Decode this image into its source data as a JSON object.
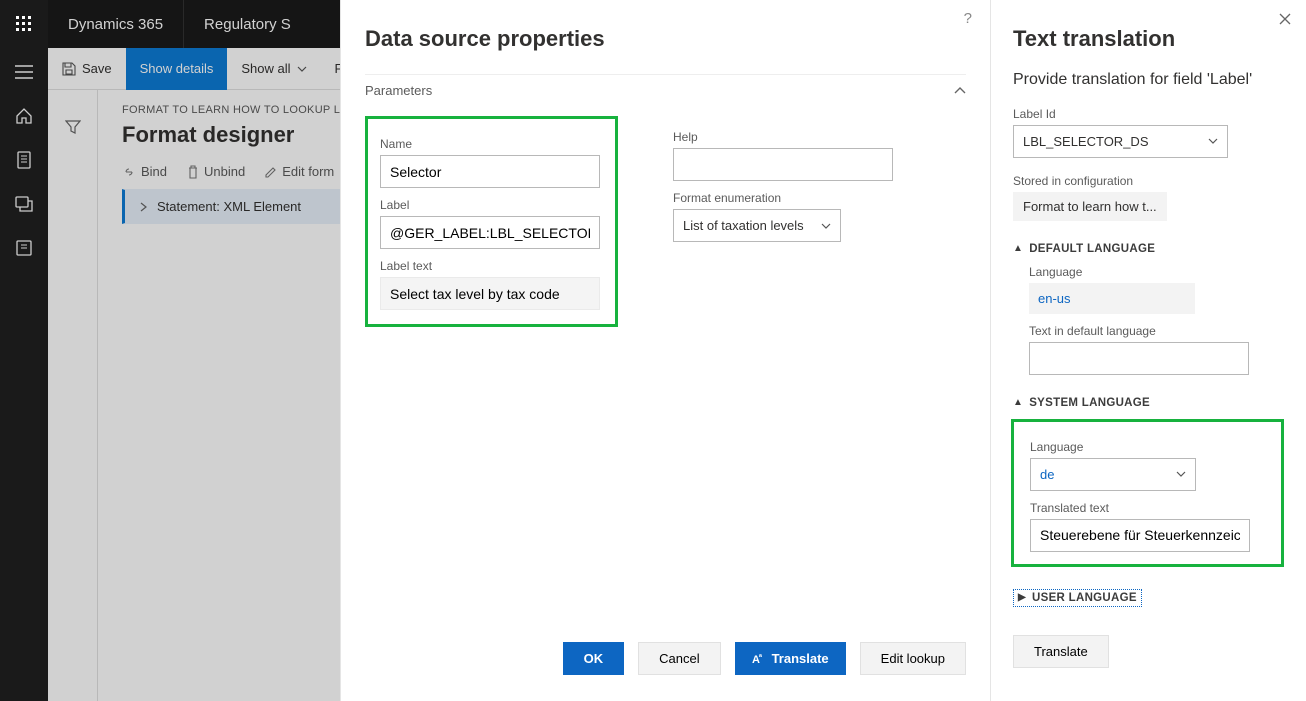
{
  "topbar": {
    "product": "Dynamics 365",
    "app": "Regulatory S"
  },
  "cmdbar": {
    "save": "Save",
    "show_details": "Show details",
    "show_all": "Show all",
    "fo": "Fo"
  },
  "page": {
    "crumb": "FORMAT TO LEARN HOW TO LOOKUP LE D",
    "title": "Format designer",
    "sub_toolbar": {
      "bind": "Bind",
      "unbind": "Unbind",
      "edit": "Edit form"
    },
    "tree_item": "Statement: XML Element"
  },
  "dialog1": {
    "title": "Data source properties",
    "section": "Parameters",
    "name_label": "Name",
    "name_value": "Selector",
    "label_label": "Label",
    "label_value": "@GER_LABEL:LBL_SELECTOR_DS",
    "labeltext_label": "Label text",
    "labeltext_value": "Select tax level by tax code",
    "help_label": "Help",
    "format_enum_label": "Format enumeration",
    "format_enum_value": "List of taxation levels",
    "ok": "OK",
    "cancel": "Cancel",
    "translate": "Translate",
    "edit_lookup": "Edit lookup"
  },
  "dialog2": {
    "title": "Text translation",
    "subtitle": "Provide translation for field 'Label'",
    "labelid_label": "Label Id",
    "labelid_value": "LBL_SELECTOR_DS",
    "stored_label": "Stored in configuration",
    "stored_value": "Format to learn how t...",
    "default_section": "DEFAULT LANGUAGE",
    "lang_label": "Language",
    "default_lang": "en-us",
    "default_text_label": "Text in default language",
    "default_text_value": "",
    "system_section": "SYSTEM LANGUAGE",
    "system_lang": "de",
    "translated_label": "Translated text",
    "translated_value": "Steuerebene für Steuerkennzeic...",
    "user_section": "USER LANGUAGE",
    "translate_btn": "Translate"
  }
}
